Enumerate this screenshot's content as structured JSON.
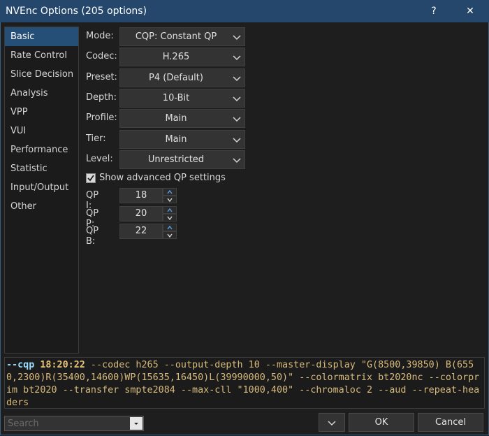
{
  "window": {
    "title": "NVEnc Options (205 options)",
    "help_label": "?",
    "close_label": "✕"
  },
  "sidebar": {
    "items": [
      {
        "label": "Basic"
      },
      {
        "label": "Rate Control"
      },
      {
        "label": "Slice Decision"
      },
      {
        "label": "Analysis"
      },
      {
        "label": "VPP"
      },
      {
        "label": "VUI"
      },
      {
        "label": "Performance"
      },
      {
        "label": "Statistic"
      },
      {
        "label": "Input/Output"
      },
      {
        "label": "Other"
      }
    ],
    "selected": "Basic"
  },
  "options": {
    "mode": {
      "label": "Mode:",
      "value": "CQP: Constant QP"
    },
    "codec": {
      "label": "Codec:",
      "value": "H.265"
    },
    "preset": {
      "label": "Preset:",
      "value": "P4 (Default)"
    },
    "depth": {
      "label": "Depth:",
      "value": "10-Bit"
    },
    "profile": {
      "label": "Profile:",
      "value": "Main"
    },
    "tier": {
      "label": "Tier:",
      "value": "Main"
    },
    "level": {
      "label": "Level:",
      "value": "Unrestricted"
    }
  },
  "advanced_qp": {
    "label": "Show advanced QP settings",
    "checked": true
  },
  "qp": {
    "i": {
      "label": "QP I:",
      "value": "18"
    },
    "p": {
      "label": "QP P:",
      "value": "20"
    },
    "b": {
      "label": "QP B:",
      "value": "22"
    }
  },
  "command_line": {
    "cqp_flag": "--cqp",
    "cqp_value": "18:20:22",
    "rest": " --codec h265 --output-depth 10 --master-display \"G(8500,39850) B(6550,2300)R(35400,14600)WP(15635,16450)L(39990000,50)\" --colormatrix bt2020nc --colorprim bt2020 --transfer smpte2084 --max-cll \"1000,400\" --chromaloc 2 --aud --repeat-headers"
  },
  "footer": {
    "search_placeholder": "Search",
    "ok_label": "OK",
    "cancel_label": "Cancel"
  },
  "colors": {
    "titlebar": "#24476b",
    "selected_item": "#264f78",
    "background": "#1e1e1e",
    "cmd_text": "#d7ba7d",
    "cmd_option": "#9cdcfe"
  }
}
